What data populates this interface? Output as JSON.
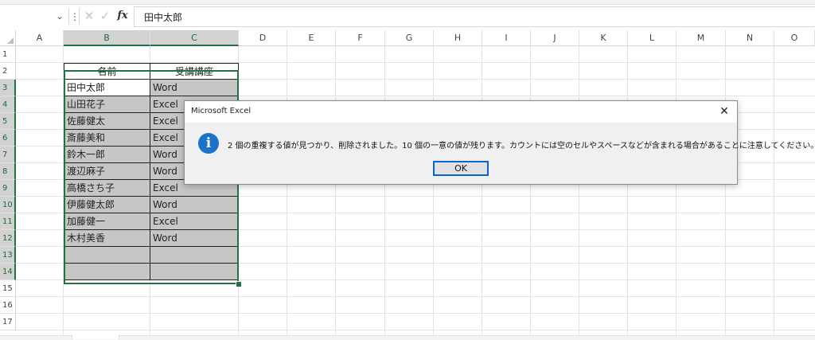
{
  "formula_bar": {
    "name_box_value": "",
    "name_box_dropdown_icon": "chevron-down-icon",
    "cancel_glyph": "✕",
    "enter_glyph": "✓",
    "fx_label": "fx",
    "formula_value": "田中太郎"
  },
  "grid": {
    "column_headers": [
      "A",
      "B",
      "C",
      "D",
      "E",
      "F",
      "G",
      "H",
      "I",
      "J",
      "K",
      "L",
      "M",
      "N",
      "O"
    ],
    "selected_columns": [
      "B",
      "C"
    ],
    "row_headers": [
      "1",
      "2",
      "3",
      "4",
      "5",
      "6",
      "7",
      "8",
      "9",
      "10",
      "11",
      "12",
      "13",
      "14",
      "15",
      "16",
      "17"
    ],
    "selected_rows": [
      "3",
      "4",
      "5",
      "6",
      "7",
      "8",
      "9",
      "10",
      "11",
      "12",
      "13",
      "14"
    ],
    "table": {
      "headers": [
        "名前",
        "受講講座"
      ],
      "rows": [
        [
          "田中太郎",
          "Word"
        ],
        [
          "山田花子",
          "Excel"
        ],
        [
          "佐藤健太",
          "Excel"
        ],
        [
          "斎藤美和",
          "Excel"
        ],
        [
          "鈴木一郎",
          "Word"
        ],
        [
          "渡辺麻子",
          "Word"
        ],
        [
          "高橋さち子",
          "Excel"
        ],
        [
          "伊藤健太郎",
          "Word"
        ],
        [
          "加藤健一",
          "Excel"
        ],
        [
          "木村美香",
          "Word"
        ],
        [
          "",
          ""
        ],
        [
          "",
          ""
        ]
      ]
    },
    "colors": {
      "selection_border": "#217346",
      "highlight_fill": "#c6c6c6",
      "header_selected_fill": "#d2d2d2"
    }
  },
  "dialog": {
    "title": "Microsoft Excel",
    "close_glyph": "✕",
    "icon": "info-icon",
    "icon_glyph": "i",
    "message": "2 個の重複する値が見つかり、削除されました。10 個の一意の値が残ります。カウントには空のセルやスペースなどが含まれる場合があることに注意してください。",
    "ok_label": "OK",
    "accent_color": "#1a73c9"
  }
}
